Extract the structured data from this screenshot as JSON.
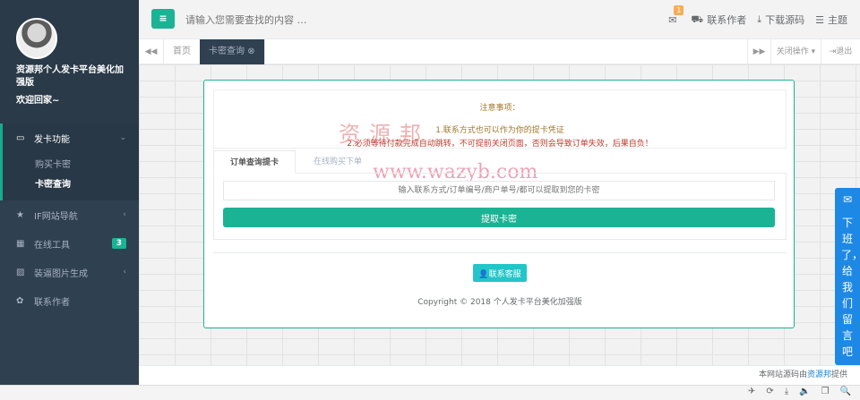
{
  "sidebar": {
    "site_name": "资源邦个人发卡平台美化加强版",
    "welcome": "欢迎回家~",
    "menu": [
      {
        "icon": "monitor-icon",
        "label": "发卡功能",
        "glyph": "▭"
      },
      {
        "icon": "star-icon",
        "label": "IF网站导航",
        "glyph": "★"
      },
      {
        "icon": "grid-icon",
        "label": "在线工具",
        "glyph": "▦",
        "badge": "3"
      },
      {
        "icon": "image-icon",
        "label": "装逼图片生成",
        "glyph": "▨"
      },
      {
        "icon": "gear-icon",
        "label": "联系作者",
        "glyph": "✿"
      }
    ],
    "submenu": [
      "购买卡密",
      "卡密查询"
    ]
  },
  "topbar": {
    "search_placeholder": "请输入您需要查找的内容 …",
    "mail_count": "1",
    "contact_author": "联系作者",
    "download_source": "下载源码",
    "theme": "主题"
  },
  "tabs": {
    "home": "首页",
    "active": "卡密查询",
    "close_ops": "关闭操作",
    "logout": "退出"
  },
  "notice": {
    "title": "注意事项：",
    "line1": "1.联系方式也可以作为你的提卡凭证",
    "line2": "2.必须等待付款完成自动跳转，不可提前关闭页面，否则会导致订单失效，后果自负！",
    "watermark_cn": "资源邦",
    "watermark_url": "www.wazyb.com"
  },
  "subtabs": {
    "active": "订单查询提卡",
    "other": "在线购买下单"
  },
  "query": {
    "placeholder": "输入联系方式/订单编号/商户单号/都可以提取到您的卡密",
    "button": "提取卡密"
  },
  "contact_button": "联系客服",
  "copyright": "Copyright © 2018 个人发卡平台美化加强版",
  "footer": {
    "prefix": "本网站源码由",
    "link": "资源邦",
    "suffix": "提供"
  },
  "float_message": "下班了，给我们留言吧",
  "colors": {
    "sidebar_bg": "#2f4050",
    "accent": "#1ab394",
    "float_blue": "#1e88e5"
  }
}
